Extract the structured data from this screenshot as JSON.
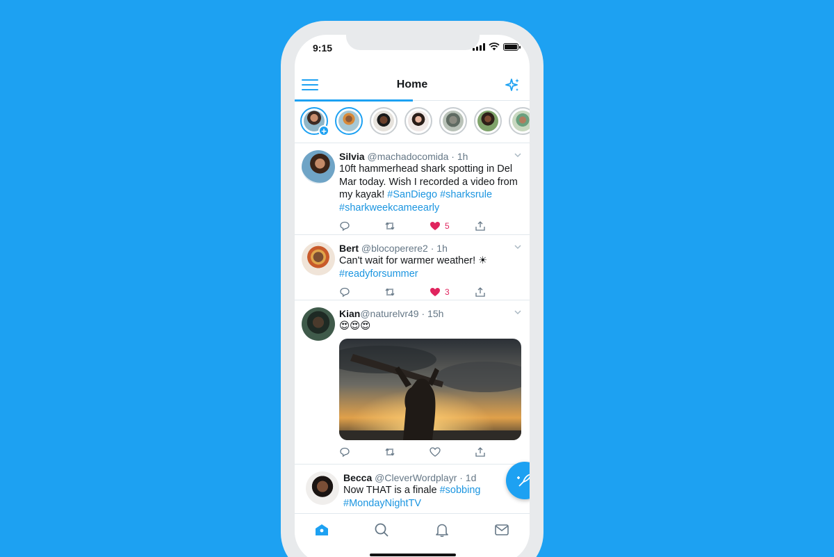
{
  "status": {
    "time": "9:15"
  },
  "header": {
    "title": "Home"
  },
  "colors": {
    "brand": "#1da1f2",
    "like": "#e0245e",
    "link": "#1b95e0",
    "text": "#14171a",
    "muted": "#657786"
  },
  "icons": {
    "menu": "menu-icon",
    "sparkle": "sparkle-icon",
    "reply": "reply-icon",
    "retweet": "retweet-icon",
    "like": "heart-icon",
    "share": "share-icon",
    "home": "home-icon",
    "search": "search-icon",
    "notifications": "bell-icon",
    "messages": "mail-icon",
    "compose": "compose-feather-icon"
  },
  "tweets": [
    {
      "name": "Silvia",
      "meta": " @machadocomida · 1h",
      "text": "10ft hammerhead shark spotting in Del Mar today. Wish I recorded a video from my kayak! ",
      "tags": "#SanDiego #sharksrule #sharkweekcameearly",
      "likes": "5"
    },
    {
      "name": "Bert",
      "meta": " @blocoperere2 · 1h",
      "text": "Can't wait for warmer weather! ☀",
      "tags": "#readyforsummer",
      "likes": "3"
    },
    {
      "name": "Kian",
      "meta": "@naturelvr49 · 15h",
      "text": "😍😍😍",
      "tags": "",
      "likes": ""
    },
    {
      "name": "Becca",
      "meta": " @CleverWordplayr · 1d",
      "text": "Now THAT is a finale ",
      "tags": "#sobbing #MondayNightTV",
      "likes": ""
    }
  ]
}
